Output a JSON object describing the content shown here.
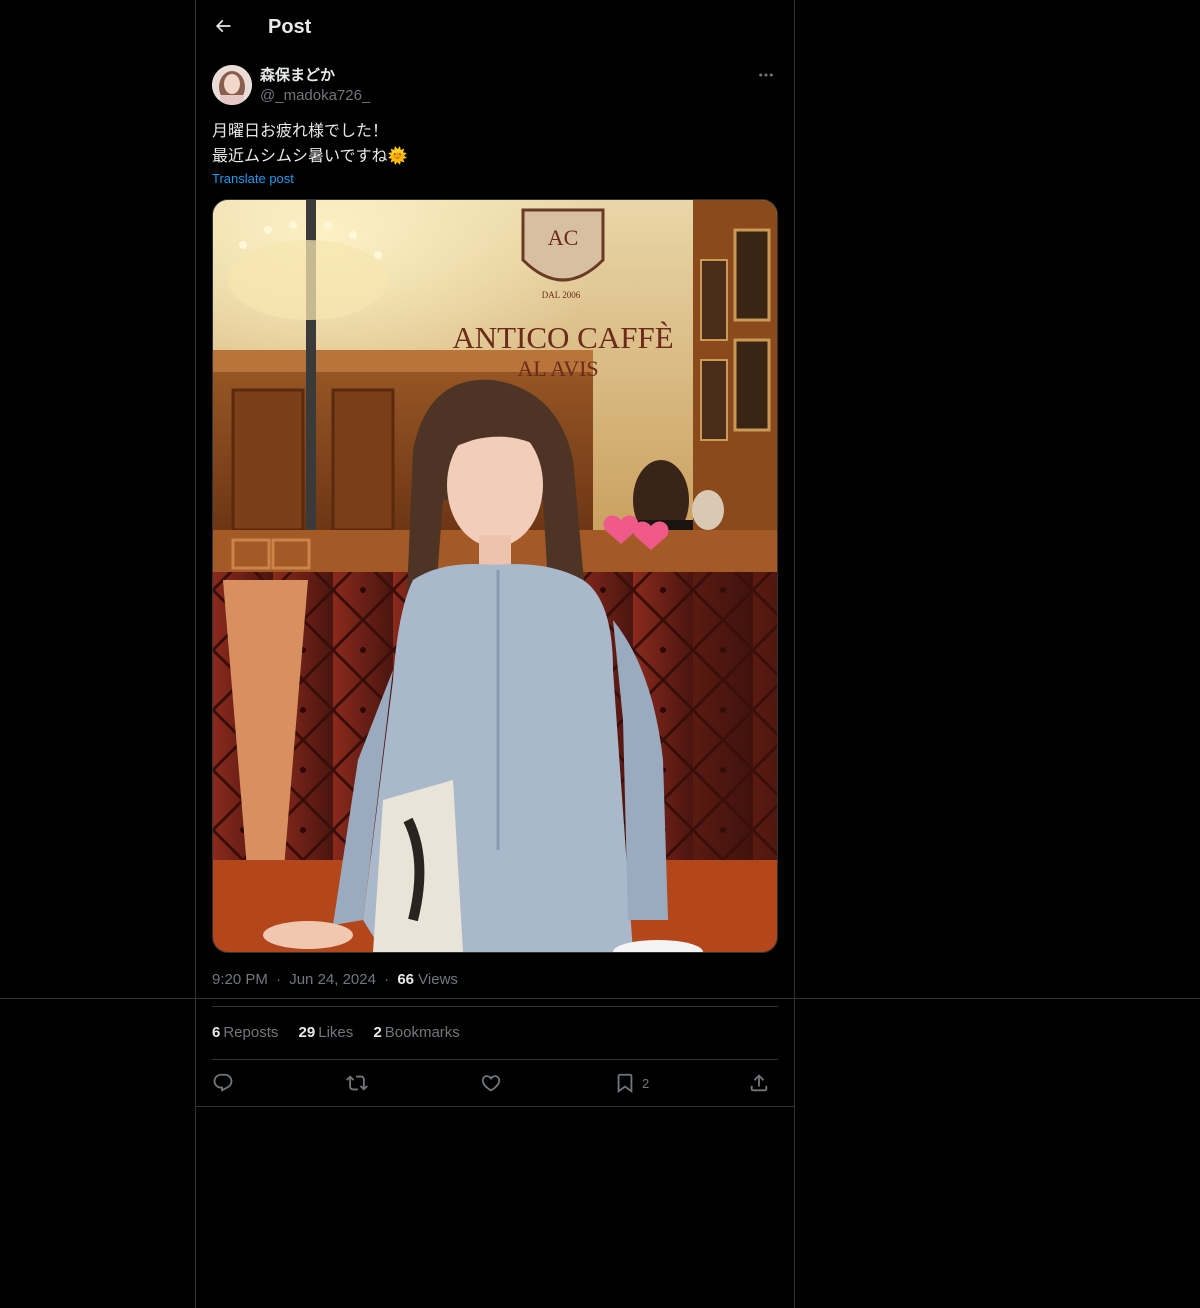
{
  "header": {
    "title": "Post",
    "back_icon": "arrow-left-icon"
  },
  "author": {
    "display_name": "森保まどか",
    "handle": "@_madoka726_",
    "avatar_icon": "avatar"
  },
  "tweet": {
    "line1": "月曜日お疲れ様でした！",
    "line2": "最近ムシムシ暑いですね🌞",
    "translate_label": "Translate post"
  },
  "media": {
    "sign_text_1": "ANTICO CAFFÈ",
    "sign_text_2": "AL AVIS",
    "crest_text": "AC",
    "crest_subtext": "DAL 2006"
  },
  "meta": {
    "time": "9:20 PM",
    "separator": "·",
    "date": "Jun 24, 2024",
    "views_count": "66",
    "views_label": "Views"
  },
  "stats": {
    "reposts_count": "6",
    "reposts_label": "Reposts",
    "likes_count": "29",
    "likes_label": "Likes",
    "bookmarks_count": "2",
    "bookmarks_label": "Bookmarks"
  },
  "actions": {
    "reply_icon": "reply-icon",
    "repost_icon": "repost-icon",
    "like_icon": "heart-icon",
    "bookmark_icon": "bookmark-icon",
    "bookmark_count": "2",
    "share_icon": "share-icon"
  },
  "colors": {
    "background": "#000000",
    "border": "#2f3336",
    "primary_text": "#e7e9ea",
    "secondary_text": "#71767b",
    "link": "#1d9bf0"
  }
}
